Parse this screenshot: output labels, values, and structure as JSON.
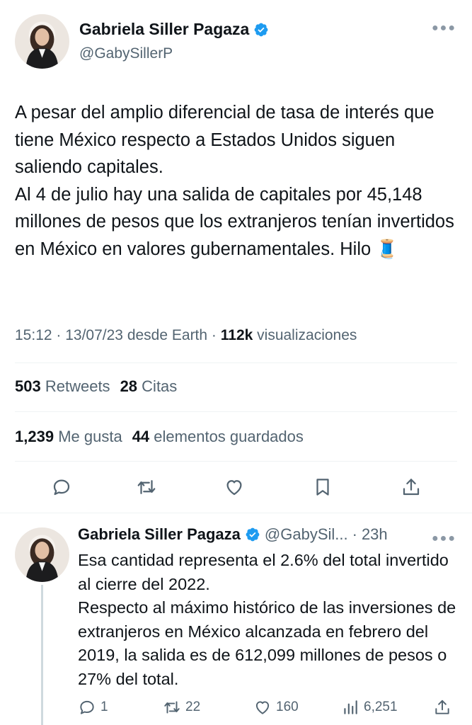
{
  "tweet": {
    "author_name": "Gabriela Siller Pagaza",
    "handle": "@GabySillerP",
    "text": "A pesar del amplio diferencial de tasa de interés que tiene México respecto a Estados Unidos siguen saliendo capitales.\nAl 4 de julio hay una salida de capitales por 45,148 millones de pesos que los extranjeros tenían invertidos en México en valores gubernamentales. Hilo 🧵",
    "time": "15:12",
    "date": "13/07/23",
    "source": "desde Earth",
    "views_count": "112k",
    "views_label": "visualizaciones",
    "retweets_count": "503",
    "retweets_label": "Retweets",
    "quotes_count": "28",
    "quotes_label": "Citas",
    "likes_count": "1,239",
    "likes_label": "Me gusta",
    "bookmarks_count": "44",
    "bookmarks_label": "elementos guardados"
  },
  "reply": {
    "author_name": "Gabriela Siller Pagaza",
    "handle": "@GabySil...",
    "time": "23h",
    "text": "Esa cantidad representa el 2.6% del total invertido al cierre del 2022.\nRespecto al máximo histórico de las inversiones de extranjeros en México alcanzada en febrero del 2019, la salida es de 612,099 millones de pesos o 27% del total.",
    "replies": "1",
    "retweets": "22",
    "likes": "160",
    "views": "6,251"
  },
  "colors": {
    "verified": "#1d9bf0",
    "secondary_text": "#536471",
    "primary_text": "#0f1419"
  },
  "icons": [
    "verified-badge-icon",
    "more-icon",
    "reply-icon",
    "retweet-icon",
    "like-icon",
    "bookmark-icon",
    "share-icon",
    "views-icon"
  ]
}
